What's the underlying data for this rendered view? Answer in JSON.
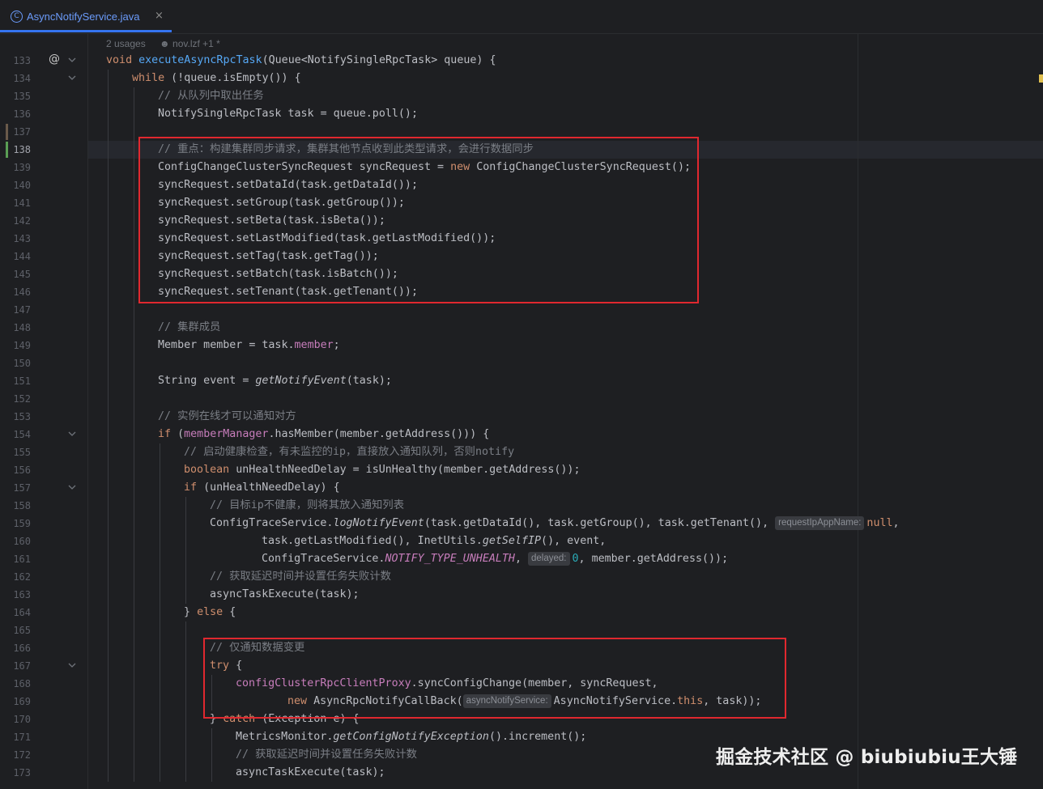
{
  "tab": {
    "icon": "java-class-icon",
    "label": "AsyncNotifyService.java",
    "close": "×"
  },
  "codelens": {
    "usages": "2 usages",
    "author": "nov.lzf +1 *"
  },
  "watermark": "掘金技术社区 @ biubiubiu王大锤",
  "current_line": 138,
  "lines": [
    {
      "n": "133",
      "indent": 0,
      "fold": true,
      "override": true,
      "tokens": [
        {
          "t": "void ",
          "c": "kw"
        },
        {
          "t": "executeAsyncRpcTask",
          "c": "fn"
        },
        {
          "t": "(Queue<NotifySingleRpcTask> queue) {"
        }
      ]
    },
    {
      "n": "134",
      "indent": 1,
      "fold": true,
      "tokens": [
        {
          "t": "while",
          "c": "kw"
        },
        {
          "t": " (!queue.isEmpty()) {"
        }
      ]
    },
    {
      "n": "135",
      "indent": 2,
      "tokens": [
        {
          "t": "// 从队列中取出任务",
          "c": "cm"
        }
      ]
    },
    {
      "n": "136",
      "indent": 2,
      "tokens": [
        {
          "t": "NotifySingleRpcTask task = queue.poll();"
        }
      ]
    },
    {
      "n": "137",
      "indent": 2,
      "vcs": "modified",
      "tokens": []
    },
    {
      "n": "138",
      "indent": 2,
      "vcs": "added",
      "tokens": [
        {
          "t": "// 重点：构建集群同步请求，集群其他节点收到此类型请求，会进行数据同步",
          "c": "cm"
        }
      ]
    },
    {
      "n": "139",
      "indent": 2,
      "tokens": [
        {
          "t": "ConfigChangeClusterSyncRequest syncRequest = "
        },
        {
          "t": "new",
          "c": "kw"
        },
        {
          "t": " ConfigChangeClusterSyncRequest();"
        }
      ]
    },
    {
      "n": "140",
      "indent": 2,
      "tokens": [
        {
          "t": "syncRequest.setDataId(task.getDataId());"
        }
      ]
    },
    {
      "n": "141",
      "indent": 2,
      "tokens": [
        {
          "t": "syncRequest.setGroup(task.getGroup());"
        }
      ]
    },
    {
      "n": "142",
      "indent": 2,
      "tokens": [
        {
          "t": "syncRequest.setBeta(task.isBeta());"
        }
      ]
    },
    {
      "n": "143",
      "indent": 2,
      "tokens": [
        {
          "t": "syncRequest.setLastModified(task.getLastModified());"
        }
      ]
    },
    {
      "n": "144",
      "indent": 2,
      "tokens": [
        {
          "t": "syncRequest.setTag(task.getTag());"
        }
      ]
    },
    {
      "n": "145",
      "indent": 2,
      "tokens": [
        {
          "t": "syncRequest.setBatch(task.isBatch());"
        }
      ]
    },
    {
      "n": "146",
      "indent": 2,
      "tokens": [
        {
          "t": "syncRequest.setTenant(task.getTenant());"
        }
      ]
    },
    {
      "n": "147",
      "indent": 2,
      "tokens": []
    },
    {
      "n": "148",
      "indent": 2,
      "tokens": [
        {
          "t": "// 集群成员",
          "c": "cm"
        }
      ]
    },
    {
      "n": "149",
      "indent": 2,
      "tokens": [
        {
          "t": "Member member = task."
        },
        {
          "t": "member",
          "c": "field"
        },
        {
          "t": ";"
        }
      ]
    },
    {
      "n": "150",
      "indent": 2,
      "tokens": []
    },
    {
      "n": "151",
      "indent": 2,
      "tokens": [
        {
          "t": "String event = "
        },
        {
          "t": "getNotifyEvent",
          "c": "static"
        },
        {
          "t": "(task);"
        }
      ]
    },
    {
      "n": "152",
      "indent": 2,
      "tokens": []
    },
    {
      "n": "153",
      "indent": 2,
      "tokens": [
        {
          "t": "// 实例在线才可以通知对方",
          "c": "cm"
        }
      ]
    },
    {
      "n": "154",
      "indent": 2,
      "fold": true,
      "tokens": [
        {
          "t": "if",
          "c": "kw"
        },
        {
          "t": " ("
        },
        {
          "t": "memberManager",
          "c": "field"
        },
        {
          "t": ".hasMember(member.getAddress())) {"
        }
      ]
    },
    {
      "n": "155",
      "indent": 3,
      "tokens": [
        {
          "t": "// 启动健康检查，有未监控的ip，直接放入通知队列，否则notify",
          "c": "cm"
        }
      ]
    },
    {
      "n": "156",
      "indent": 3,
      "tokens": [
        {
          "t": "boolean",
          "c": "kw"
        },
        {
          "t": " unHealthNeedDelay = isUnHealthy(member.getAddress());"
        }
      ]
    },
    {
      "n": "157",
      "indent": 3,
      "fold": true,
      "tokens": [
        {
          "t": "if",
          "c": "kw"
        },
        {
          "t": " (unHealthNeedDelay) {"
        }
      ]
    },
    {
      "n": "158",
      "indent": 4,
      "tokens": [
        {
          "t": "// 目标ip不健康，则将其放入通知列表",
          "c": "cm"
        }
      ]
    },
    {
      "n": "159",
      "indent": 4,
      "tokens": [
        {
          "t": "ConfigTraceService."
        },
        {
          "t": "logNotifyEvent",
          "c": "static"
        },
        {
          "t": "(task.getDataId(), task.getGroup(), task.getTenant(), "
        },
        {
          "t": "requestIpAppName:",
          "c": "hint"
        },
        {
          "t": "null",
          "c": "kw"
        },
        {
          "t": ","
        }
      ]
    },
    {
      "n": "160",
      "indent": 6,
      "guides": 4,
      "tokens": [
        {
          "t": "task.getLastModified(), InetUtils."
        },
        {
          "t": "getSelfIP",
          "c": "static"
        },
        {
          "t": "(), event,"
        }
      ]
    },
    {
      "n": "161",
      "indent": 6,
      "guides": 4,
      "tokens": [
        {
          "t": "ConfigTraceService."
        },
        {
          "t": "NOTIFY_TYPE_UNHEALTH",
          "c": "fstatic"
        },
        {
          "t": ", "
        },
        {
          "t": "delayed:",
          "c": "hint"
        },
        {
          "t": "0",
          "c": "num"
        },
        {
          "t": ", member.getAddress());"
        }
      ]
    },
    {
      "n": "162",
      "indent": 4,
      "tokens": [
        {
          "t": "// 获取延迟时间并设置任务失败计数",
          "c": "cm"
        }
      ]
    },
    {
      "n": "163",
      "indent": 4,
      "tokens": [
        {
          "t": "asyncTaskExecute(task);"
        }
      ]
    },
    {
      "n": "164",
      "indent": 3,
      "tokens": [
        {
          "t": "} "
        },
        {
          "t": "else",
          "c": "kw"
        },
        {
          "t": " {"
        }
      ]
    },
    {
      "n": "165",
      "indent": 4,
      "tokens": []
    },
    {
      "n": "166",
      "indent": 4,
      "tokens": [
        {
          "t": "// 仅通知数据变更",
          "c": "cm"
        }
      ]
    },
    {
      "n": "167",
      "indent": 4,
      "fold": true,
      "tokens": [
        {
          "t": "try",
          "c": "kw"
        },
        {
          "t": " {"
        }
      ]
    },
    {
      "n": "168",
      "indent": 5,
      "tokens": [
        {
          "t": "configClusterRpcClientProxy",
          "c": "field"
        },
        {
          "t": ".syncConfigChange(member, syncRequest,"
        }
      ]
    },
    {
      "n": "169",
      "indent": 7,
      "guides": 5,
      "tokens": [
        {
          "t": "new",
          "c": "kw"
        },
        {
          "t": " AsyncRpcNotifyCallBack("
        },
        {
          "t": "asyncNotifyService:",
          "c": "hint"
        },
        {
          "t": "AsyncNotifyService."
        },
        {
          "t": "this",
          "c": "kw"
        },
        {
          "t": ", task));"
        }
      ]
    },
    {
      "n": "170",
      "indent": 4,
      "tokens": [
        {
          "t": "} "
        },
        {
          "t": "catch",
          "c": "kw"
        },
        {
          "t": " (Exception e) {"
        }
      ]
    },
    {
      "n": "171",
      "indent": 5,
      "tokens": [
        {
          "t": "MetricsMonitor."
        },
        {
          "t": "getConfigNotifyException",
          "c": "static"
        },
        {
          "t": "().increment();"
        }
      ]
    },
    {
      "n": "172",
      "indent": 5,
      "tokens": [
        {
          "t": "// 获取延迟时间并设置任务失败计数",
          "c": "cm"
        }
      ]
    },
    {
      "n": "173",
      "indent": 5,
      "tokens": [
        {
          "t": "asyncTaskExecute(task);"
        }
      ]
    }
  ]
}
